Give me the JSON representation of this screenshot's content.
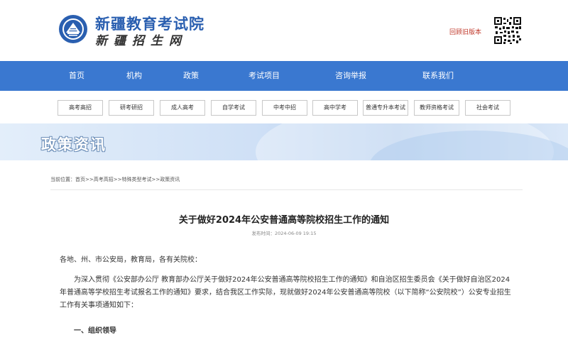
{
  "header": {
    "site_title": "新疆教育考试院",
    "site_subtitle": "新疆招生网",
    "old_version_link": "回顾旧版本"
  },
  "nav": {
    "items": [
      {
        "label": "首页"
      },
      {
        "label": "机构"
      },
      {
        "label": "政策"
      },
      {
        "label": "考试项目"
      },
      {
        "label": "咨询举报"
      },
      {
        "label": "联系我们"
      }
    ]
  },
  "categories": [
    {
      "label": "高考高招"
    },
    {
      "label": "研考研招"
    },
    {
      "label": "成人高考"
    },
    {
      "label": "自学考试"
    },
    {
      "label": "中考中招"
    },
    {
      "label": "高中学考"
    },
    {
      "label": "普通专升本考试"
    },
    {
      "label": "教师资格考试"
    },
    {
      "label": "社会考试"
    }
  ],
  "banner": {
    "title": "政策资讯"
  },
  "breadcrumb": {
    "label": "当前位置：",
    "items": [
      "首页",
      ">>高考高招",
      ">>特殊类型考试",
      ">>政策资讯"
    ]
  },
  "article": {
    "title": "关于做好2024年公安普通高等院校招生工作的通知",
    "meta_label": "发布时间：",
    "meta_date": "2024-06-09 19:15",
    "salutation": "各地、州、市公安局，教育局，各有关院校：",
    "body": "为深入贯彻《公安部办公厅 教育部办公厅关于做好2024年公安普通高等院校招生工作的通知》和自治区招生委员会《关于做好自治区2024年普通高等学校招生考试报名工作的通知》要求，结合我区工作实际，现就做好2024年公安普通高等院校（以下简称“公安院校”）公安专业招生工作有关事项通知如下：",
    "heading_1": "一、组织领导"
  },
  "colors": {
    "nav_bg": "#3a78d0",
    "title_blue": "#2a5fb0",
    "old_version_red": "#c0392b"
  }
}
